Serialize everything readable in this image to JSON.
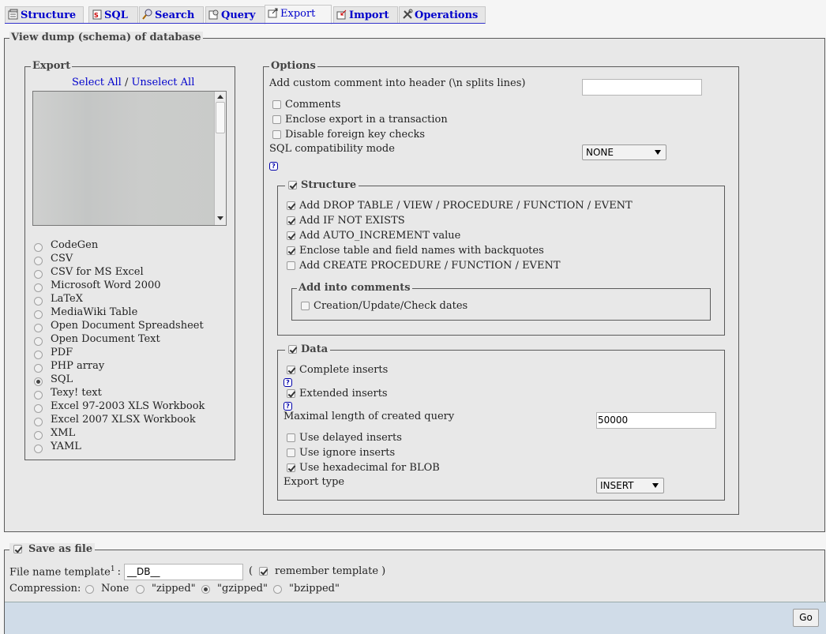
{
  "tabs": [
    {
      "label": "Structure",
      "icon": "structure-icon"
    },
    {
      "label": "SQL",
      "icon": "sql-icon"
    },
    {
      "label": "Search",
      "icon": "search-icon"
    },
    {
      "label": "Query",
      "icon": "query-icon"
    },
    {
      "label": "Export",
      "icon": "export-icon",
      "active": true
    },
    {
      "label": "Import",
      "icon": "import-icon"
    },
    {
      "label": "Operations",
      "icon": "operations-icon"
    }
  ],
  "main": {
    "legend": "View dump (schema) of database"
  },
  "export": {
    "legend": "Export",
    "select_all": "Select All",
    "separator": "/",
    "unselect_all": "Unselect All",
    "formats": [
      "CodeGen",
      "CSV",
      "CSV for MS Excel",
      "Microsoft Word 2000",
      "LaTeX",
      "MediaWiki Table",
      "Open Document Spreadsheet",
      "Open Document Text",
      "PDF",
      "PHP array",
      "SQL",
      "Texy! text",
      "Excel 97-2003 XLS Workbook",
      "Excel 2007 XLSX Workbook",
      "XML",
      "YAML"
    ],
    "selected_format": "SQL"
  },
  "options": {
    "legend": "Options",
    "custom_comment_label": "Add custom comment into header (\\n splits lines)",
    "custom_comment_value": "",
    "comments_label": "Comments",
    "transaction_label": "Enclose export in a transaction",
    "foreign_key_label": "Disable foreign key checks",
    "compat_label": "SQL compatibility mode",
    "compat_value": "NONE",
    "help_icon": "?"
  },
  "structure": {
    "legend": "Structure",
    "drop_table": "Add DROP TABLE / VIEW / PROCEDURE / FUNCTION / EVENT",
    "if_not_exists": "Add IF NOT EXISTS",
    "auto_increment": "Add AUTO_INCREMENT value",
    "backquotes": "Enclose table and field names with backquotes",
    "create_procedure": "Add CREATE PROCEDURE / FUNCTION / EVENT",
    "comments_legend": "Add into comments",
    "dates_label": "Creation/Update/Check dates"
  },
  "data": {
    "legend": "Data",
    "complete_inserts": "Complete inserts",
    "extended_inserts": "Extended inserts",
    "max_length_label": "Maximal length of created query",
    "max_length_value": "50000",
    "delayed_inserts": "Use delayed inserts",
    "ignore_inserts": "Use ignore inserts",
    "hex_blob": "Use hexadecimal for BLOB",
    "export_type_label": "Export type",
    "export_type_value": "INSERT"
  },
  "save": {
    "legend": "Save as file",
    "template_label": "File name template",
    "template_sup": "1",
    "template_colon": ":",
    "template_value": "__DB__",
    "paren_open": "(",
    "remember_label": "remember template",
    "paren_close": ")",
    "compression_label": "Compression:",
    "compression_options": [
      "None",
      "\"zipped\"",
      "\"gzipped\"",
      "\"bzipped\""
    ],
    "compression_selected": "\"gzipped\"",
    "go_label": "Go"
  }
}
